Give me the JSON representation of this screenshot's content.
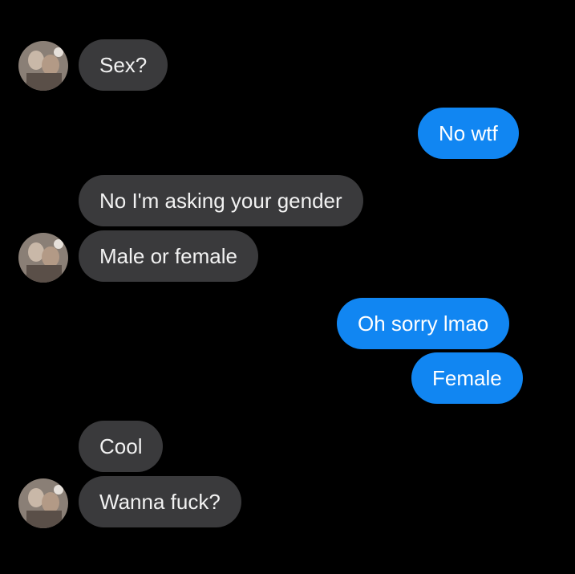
{
  "conversation": {
    "messages": [
      {
        "from": "other",
        "text": "Sex?"
      },
      {
        "from": "me",
        "text": "No wtf"
      },
      {
        "from": "other",
        "text": "No I'm asking your gender"
      },
      {
        "from": "other",
        "text": "Male or female"
      },
      {
        "from": "me",
        "text": "Oh sorry lmao"
      },
      {
        "from": "me",
        "text": "Female"
      },
      {
        "from": "other",
        "text": "Cool"
      },
      {
        "from": "other",
        "text": "Wanna fuck?"
      }
    ]
  },
  "colors": {
    "background": "#000000",
    "incoming_bubble": "#3a3a3c",
    "outgoing_bubble": "#1186f2"
  },
  "icons": {
    "avatar": "contact-avatar-photo"
  }
}
